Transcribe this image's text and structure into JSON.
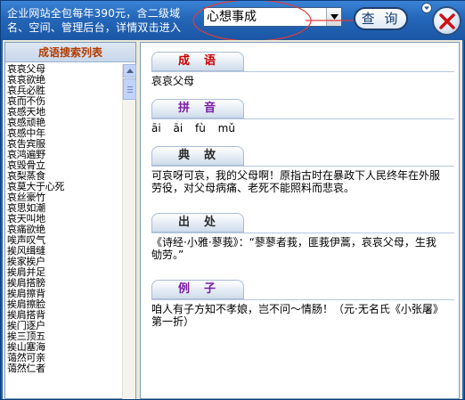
{
  "titlebar": {
    "ad_text": "企业网站全包每年390元，含二级域名、空间、管理后台，详情双击进入",
    "combo_value": "心想事成",
    "query_label": "查 询",
    "close_label": "×"
  },
  "colors": {
    "titlebar": "#2466b8",
    "tag_red": "#cc0000",
    "tag_purple": "#7a1ca8",
    "tag_dark": "#3a1a66",
    "list_header_text": "#b23c00"
  },
  "list": {
    "header": "成语搜索列表",
    "items": [
      "哀哀父母",
      "哀哀欲绝",
      "哀兵必胜",
      "哀而不伤",
      "哀感天地",
      "哀感顽艳",
      "哀感中年",
      "哀吿宾服",
      "哀鸿遍野",
      "哀毁骨立",
      "哀梨蒸食",
      "哀莫大于心死",
      "哀丝豪竹",
      "哀思如潮",
      "哀天叫地",
      "哀痛欲绝",
      "唉声叹气",
      "挨风缉缝",
      "挨家挨户",
      "挨肩并足",
      "挨肩搭膀",
      "挨肩擦背",
      "挨肩擦脸",
      "挨肩搭背",
      "挨门逐户",
      "挨三顶五",
      "挨山塞海",
      "蔼然可亲",
      "蔼然仁者"
    ]
  },
  "detail": {
    "sections": [
      {
        "label": "成语",
        "color": "#cc0000",
        "text": "哀哀父母"
      },
      {
        "label": "拼音",
        "color": "#7a1ca8",
        "text": "āi āi fù mǔ"
      },
      {
        "label": "典故",
        "color": "#2b2b2b",
        "text": "可哀呀可哀，我的父母啊！原指古时在暴政下人民终年在外服劳役，对父母病痛、老死不能照料而悲哀。"
      },
      {
        "label": "出处",
        "color": "#2b2b2b",
        "text": "《诗经·小雅·蓼莪》：“蓼蓼者莪，匪莪伊蒿，哀哀父母，生我劬劳。”"
      },
      {
        "label": "例子",
        "color": "#7a1ca8",
        "text": "咱人有子方知不孝娘，岂不问～情肠！（元·无名氏《小张屠》第一折）"
      }
    ]
  }
}
